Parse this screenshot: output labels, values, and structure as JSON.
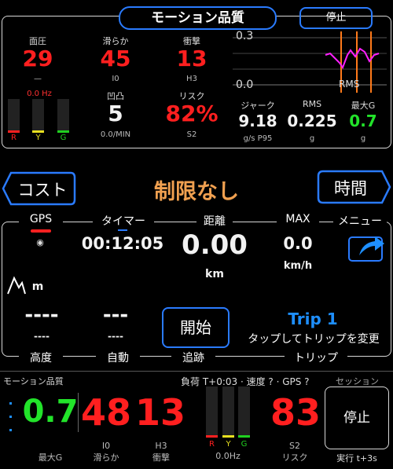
{
  "top": {
    "title": "モーション品質",
    "stop_label": "停止",
    "metrics": [
      {
        "label": "面圧",
        "value": "29",
        "sub": "—"
      },
      {
        "label": "滑らか",
        "value": "45",
        "sub": "I0"
      },
      {
        "label": "衝撃",
        "value": "13",
        "sub": "H3"
      }
    ],
    "hz_label": "0.0 Hz",
    "rgb": [
      "R",
      "Y",
      "G"
    ],
    "bump": {
      "label": "凹凸",
      "value": "5",
      "sub": "0.0/MIN"
    },
    "risk": {
      "label": "リスク",
      "value": "82%",
      "sub": "S2"
    },
    "graph": {
      "top": "0.3",
      "bottom": "0.0",
      "rms": "RMS"
    },
    "jerk": {
      "label": "ジャーク",
      "value": "9.18",
      "sub": "g/s P95"
    },
    "rms": {
      "label": "RMS",
      "value": "0.225",
      "sub": "g"
    },
    "maxg": {
      "label": "最大G",
      "value": "0.7",
      "sub": "g"
    }
  },
  "mid": {
    "cost_label": "コスト",
    "limit_label": "制限なし",
    "time_label": "時間",
    "row1": [
      "GPS",
      "タイマー",
      "距離",
      "MAX",
      "メニュー"
    ],
    "timer": "00:12:05",
    "distance": "0.00",
    "distance_unit": "km",
    "max": "0.0",
    "max_unit": "km/h",
    "alt_unit": "m",
    "dash_big1": "----",
    "dash_small1": "----",
    "dash_big2": "---",
    "dash_small2": "----",
    "start_label": "開始",
    "trip_title": "Trip 1",
    "trip_sub": "タップしてトリップを変更",
    "row2": [
      "高度",
      "自動",
      "追跡",
      "トリップ"
    ]
  },
  "bottom": {
    "title": "モーション品質",
    "status": "負荷 T+0:03 · 速度 ? · GPS ?",
    "session": "セッション",
    "maxg": {
      "value": "0.7",
      "label": "最大G"
    },
    "smooth": {
      "value": "48",
      "label": "I0",
      "label2": "滑らか"
    },
    "impact": {
      "value": "13",
      "label": "H3",
      "label2": "衝撃"
    },
    "rgb": [
      "R",
      "Y",
      "G"
    ],
    "hz": "0.0Hz",
    "risk": {
      "value": "83",
      "label": "S2",
      "label2": "リスク"
    },
    "stop_label": "停止",
    "exec_label": "実行  t+3s"
  }
}
